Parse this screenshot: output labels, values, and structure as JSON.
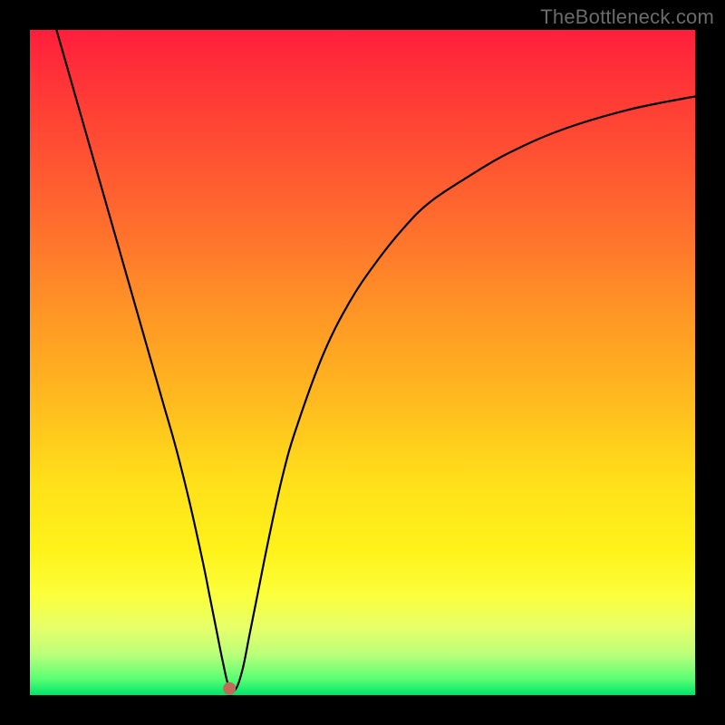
{
  "watermark": "TheBottleneck.com",
  "chart_data": {
    "type": "line",
    "title": "",
    "xlabel": "",
    "ylabel": "",
    "xlim": [
      0,
      100
    ],
    "ylim": [
      0,
      100
    ],
    "series": [
      {
        "name": "bottleneck-curve",
        "x": [
          4,
          6,
          8,
          10,
          12,
          14,
          16,
          18,
          20,
          22,
          24,
          26,
          27,
          28,
          29,
          30,
          31,
          32,
          33,
          34,
          36,
          38,
          40,
          44,
          48,
          52,
          56,
          60,
          66,
          72,
          80,
          90,
          100
        ],
        "values": [
          100,
          93,
          86,
          79,
          72,
          65,
          58,
          51,
          44,
          37,
          29,
          20,
          15,
          10,
          5,
          1,
          1,
          4,
          9,
          14,
          24,
          33,
          40,
          51,
          59,
          65,
          70,
          74,
          78,
          81.5,
          85,
          88,
          90
        ]
      }
    ],
    "marker": {
      "x": 30,
      "y": 1
    },
    "grid": false,
    "legend": false
  }
}
